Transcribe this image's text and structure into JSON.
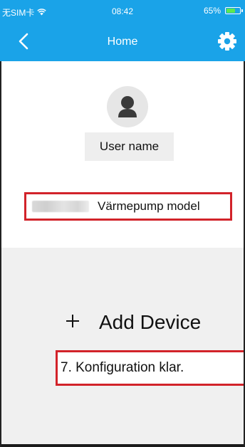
{
  "status_bar": {
    "carrier": "无SIM卡",
    "time": "08:42",
    "battery": "65%",
    "battery_level": 0.65
  },
  "nav": {
    "title": "Home",
    "back_icon": "chevron-left-icon",
    "settings_icon": "gear-icon"
  },
  "profile": {
    "avatar_icon": "user-icon",
    "username": "User name"
  },
  "model": {
    "label": "Värmepump model"
  },
  "device": {
    "add_icon": "plus-icon",
    "add_label": "Add Device",
    "config_label": "7. Konfiguration klar."
  },
  "colors": {
    "brand_blue": "#1aa3e8",
    "highlight_red": "#d2232a",
    "battery_green": "#5ee84c"
  }
}
